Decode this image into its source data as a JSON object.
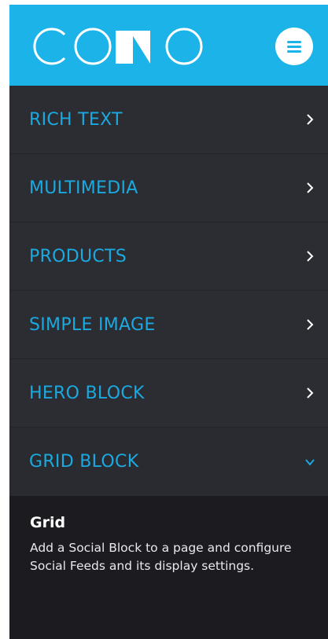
{
  "brand": {
    "logo_text": "COMO",
    "primary_color": "#1cb3e8",
    "icon": "como-logo"
  },
  "header": {
    "menu_icon": "hamburger-menu-icon"
  },
  "nav": {
    "items": [
      {
        "label": "RICH TEXT",
        "icon": "chevron-right-icon",
        "expanded": false
      },
      {
        "label": "MULTIMEDIA",
        "icon": "chevron-right-icon",
        "expanded": false
      },
      {
        "label": "PRODUCTS",
        "icon": "chevron-right-icon",
        "expanded": false
      },
      {
        "label": "SIMPLE IMAGE",
        "icon": "chevron-right-icon",
        "expanded": false
      },
      {
        "label": "HERO BLOCK",
        "icon": "chevron-right-icon",
        "expanded": false
      },
      {
        "label": "GRID BLOCK",
        "icon": "chevron-down-icon",
        "expanded": true
      }
    ],
    "label_color": "#1aa9e0"
  },
  "panel": {
    "title": "Grid",
    "description": "Add a Social Block to a page and configure Social Feeds and its display settings."
  }
}
